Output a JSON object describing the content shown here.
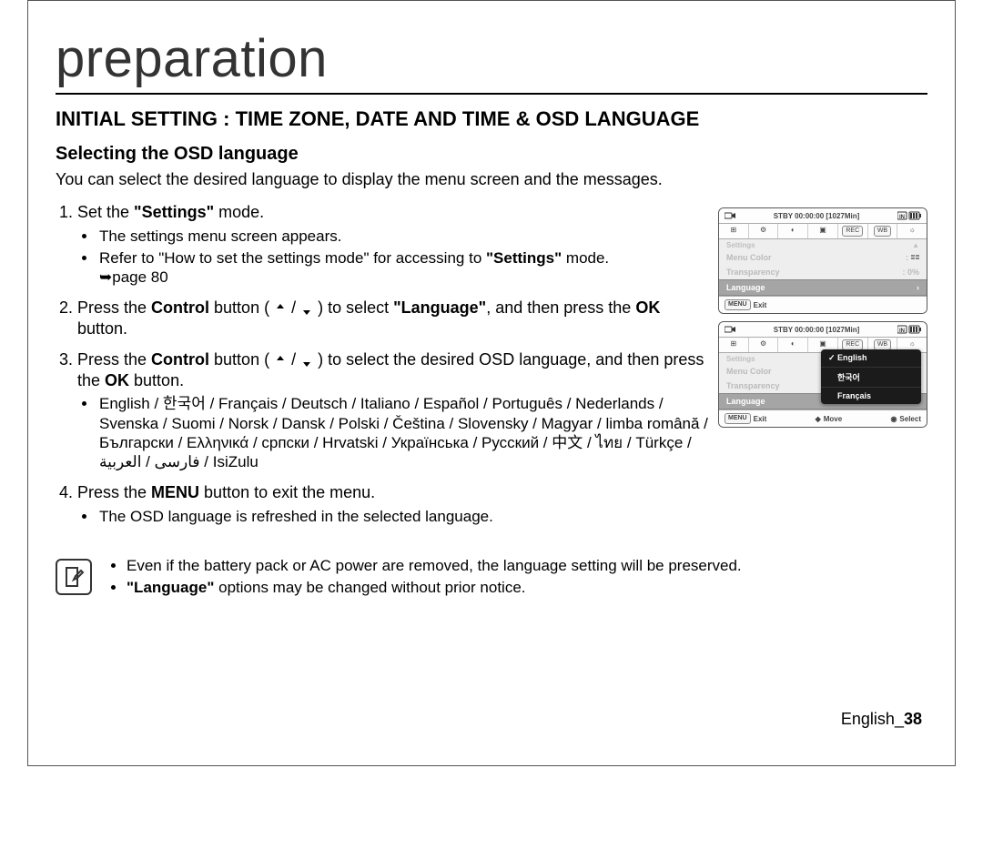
{
  "chapter": "preparation",
  "section_title": "INITIAL SETTING : TIME ZONE, DATE AND TIME & OSD LANGUAGE",
  "subsection_title": "Selecting the OSD language",
  "intro": "You can select the desired language to display the menu screen and the messages.",
  "steps": {
    "s1": {
      "num": "1.",
      "text_prefix": "Set the ",
      "bold1": "\"Settings\"",
      "text_suffix": " mode.",
      "b1": "The settings menu screen appears.",
      "b2_prefix": "Refer to \"How to set the settings mode\" for accessing to ",
      "b2_bold": "\"Settings\"",
      "b2_suffix": " mode.",
      "b2_page": "➥page 80"
    },
    "s2": {
      "num": "2.",
      "prefix": "Press the ",
      "bold1": "Control",
      "mid1": " button ( ",
      "mid2": " ) to select ",
      "bold2": "\"Language\"",
      "mid3": ", and then press the ",
      "bold3": "OK",
      "suffix": " button."
    },
    "s3": {
      "num": "3.",
      "prefix": "Press the ",
      "bold1": "Control",
      "mid1": " button ( ",
      "mid2": " ) to select the desired OSD language, and then press the ",
      "bold2": "OK",
      "suffix": " button.",
      "langs": "English / 한국어 / Français / Deutsch / Italiano / Español / Português / Nederlands / Svenska / Suomi / Norsk / Dansk / Polski / Čeština / Slovensky / Magyar / limba română / Български / Ελληνικά / српски / Hrvatski / Українська / Русский / 中文 / ไทย / Türkçe / فارسی / العربية / IsiZulu"
    },
    "s4": {
      "num": "4.",
      "prefix": "Press the ",
      "bold1": "MENU",
      "suffix": " button to exit the menu.",
      "b1": "The OSD language is refreshed in the selected language."
    }
  },
  "notes": {
    "n1": "Even if the battery pack or AC power are removed, the language setting will be preserved.",
    "n2_bold": "\"Language\"",
    "n2_rest": " options may be changed without prior notice."
  },
  "osd1": {
    "status": "STBY 00:00:00 [1027Min]",
    "heading": "Settings",
    "r1": "Menu Color",
    "r2": "Transparency",
    "r2v": ": 0%",
    "r3": "Language",
    "exit_label": "Exit",
    "menu_chip": "MENU"
  },
  "osd2": {
    "status": "STBY 00:00:00 [1027Min]",
    "heading": "Settings",
    "r1": "Menu Color",
    "r2": "Transparency",
    "r3": "Language",
    "exit_label": "Exit",
    "move_label": "Move",
    "select_label": "Select",
    "menu_chip": "MENU",
    "popup": {
      "o1": "English",
      "o2": "한국어",
      "o3": "Français"
    }
  },
  "page_number": {
    "lang": "English",
    "sep": "_",
    "num": "38"
  }
}
